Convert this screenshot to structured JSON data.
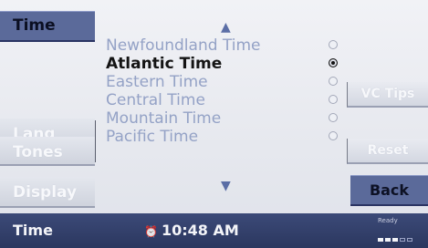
{
  "sidebar": {
    "tabs": [
      {
        "label": "Time",
        "active": true
      },
      {
        "label": "Lang",
        "active": false
      },
      {
        "label": "Tones",
        "active": false
      },
      {
        "label": "Display",
        "active": false
      }
    ]
  },
  "timezones": {
    "items": [
      {
        "label": "Newfoundland Time",
        "selected": false
      },
      {
        "label": "Atlantic Time",
        "selected": true
      },
      {
        "label": "Eastern Time",
        "selected": false
      },
      {
        "label": "Central Time",
        "selected": false
      },
      {
        "label": "Mountain Time",
        "selected": false
      },
      {
        "label": "Pacific Time",
        "selected": false
      }
    ],
    "scroll_up_icon": "up-triangle",
    "scroll_down_icon": "down-triangle"
  },
  "buttons": {
    "vc_tips": "VC Tips",
    "reset": "Reset",
    "back": "Back"
  },
  "status_bar": {
    "title": "Time",
    "clock": "10:48 AM",
    "clock_icon": "alarm-icon",
    "ready": "Ready",
    "signal_bars": 3
  },
  "colors": {
    "accent": "#5b6a9a",
    "status_bar": "#2f3a63",
    "selected_text": "#141414",
    "muted_text": "#94a2c6"
  }
}
